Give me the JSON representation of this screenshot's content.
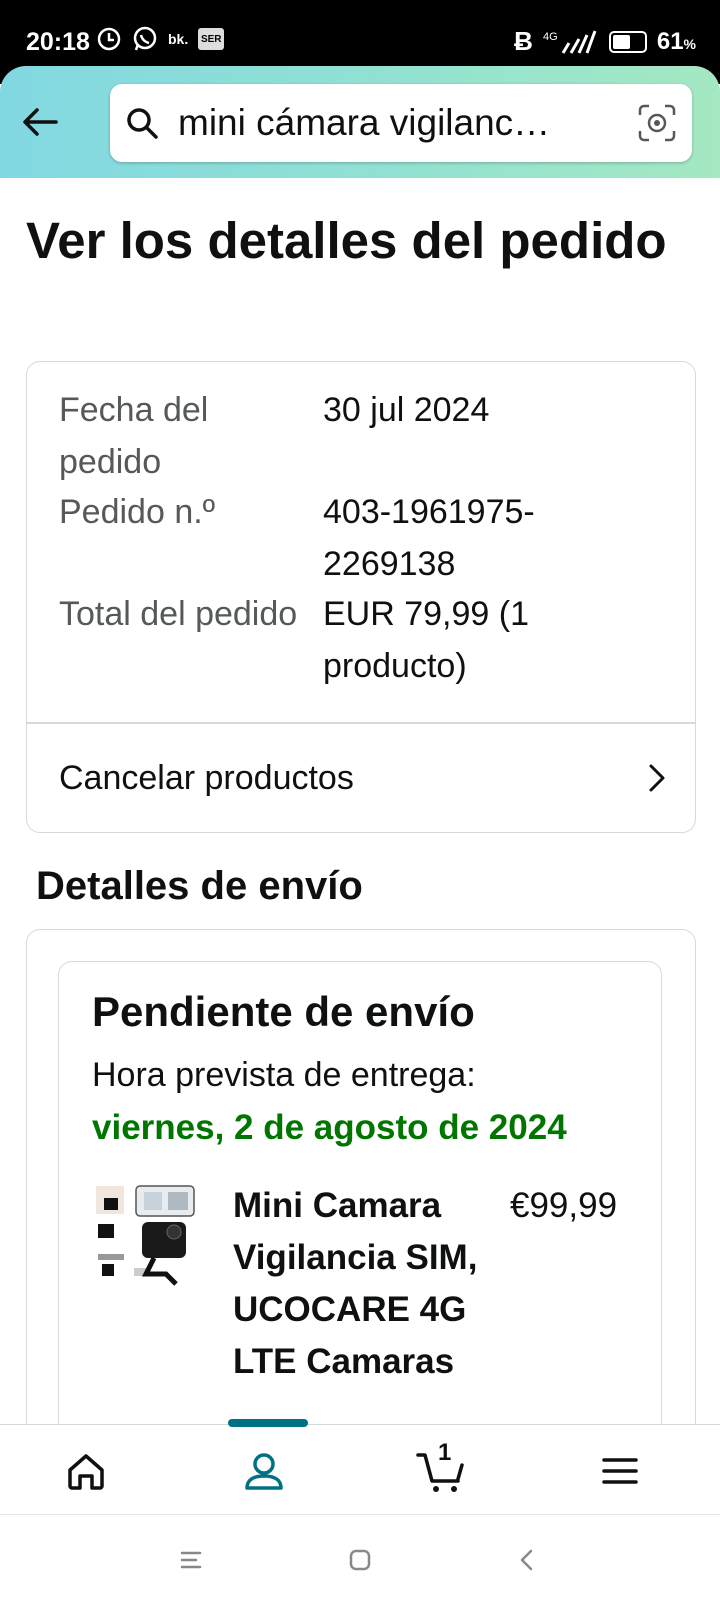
{
  "status_bar": {
    "time": "20:18",
    "left_icons": [
      "alarm-icon",
      "whatsapp-icon",
      "bk",
      "SER"
    ],
    "bk_label": "bk.",
    "ser_label": "SER",
    "network": "4G",
    "battery_percent": "61",
    "battery_level": 0.61,
    "percent_sign": "%"
  },
  "search": {
    "query": "mini cámara vigilanc…",
    "icons": [
      "back-arrow-icon",
      "search-icon",
      "camera-lens-icon"
    ]
  },
  "page": {
    "title": "Ver los detalles del pedido"
  },
  "order": {
    "date_label": "Fecha del pedido",
    "date_value": "30 jul 2024",
    "number_label": "Pedido n.º",
    "number_value": "403-1961975-2269138",
    "total_label": "Total del pedido",
    "total_value": "EUR 79,99 (1 producto)",
    "cancel_label": "Cancelar productos"
  },
  "shipping": {
    "section_title": "Detalles de envío",
    "status": "Pendiente de envío",
    "eta_label": "Hora prevista de entrega:",
    "eta_date": "viernes, 2 de agosto de 2024",
    "product": {
      "name": "Mini Camara Vigilancia SIM, UCOCARE 4G LTE Camaras",
      "price": "€99,99"
    }
  },
  "bottom_nav": {
    "items": [
      "home-icon",
      "account-icon",
      "cart-icon",
      "menu-icon"
    ],
    "active": "account-icon",
    "cart_count": "1"
  },
  "system_nav": {
    "buttons": [
      "recent-apps-icon",
      "home-button-icon",
      "back-icon"
    ]
  },
  "colors": {
    "header_gradient_start": "#82d8e2",
    "header_gradient_end": "#a5e8c2",
    "delivery_green": "#007600",
    "active_nav": "#007185"
  }
}
